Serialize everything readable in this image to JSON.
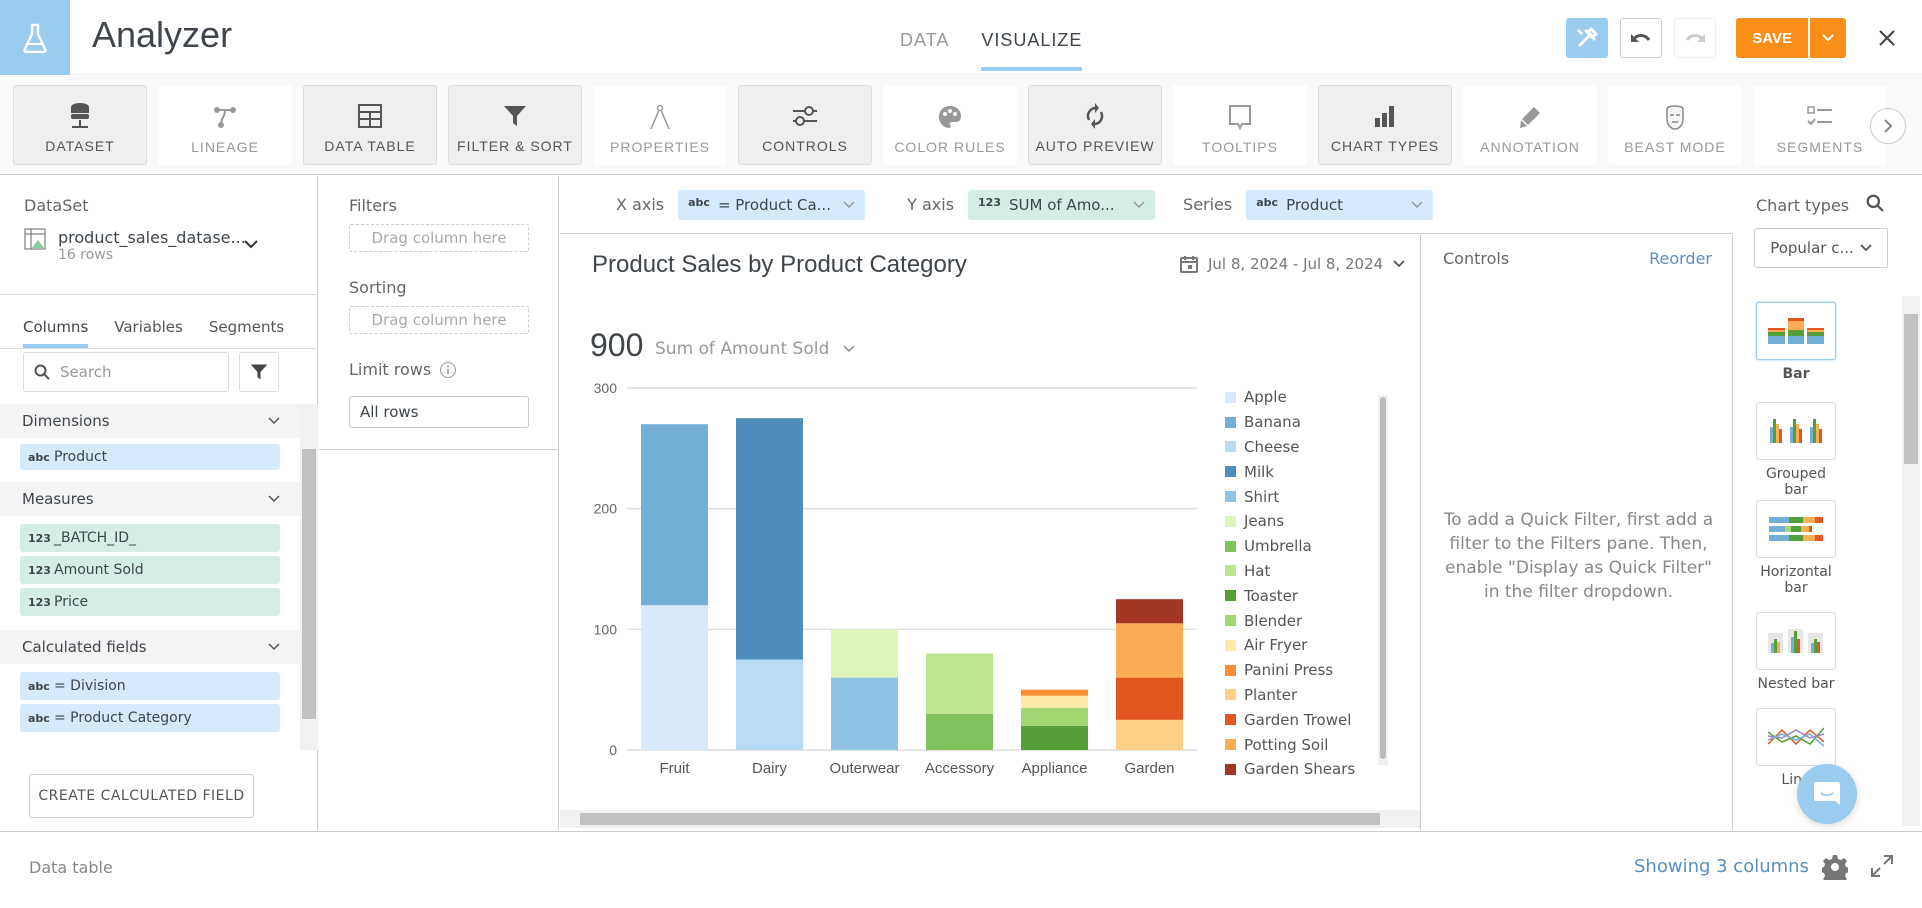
{
  "app": {
    "title": "Analyzer",
    "logo_icon": "flask-icon"
  },
  "nav": {
    "tabs": [
      {
        "label": "DATA",
        "active": false
      },
      {
        "label": "VISUALIZE",
        "active": true
      }
    ]
  },
  "header_actions": {
    "save_label": "SAVE",
    "tools_icon": "tools-icon",
    "undo_icon": "undo-icon",
    "redo_icon": "redo-icon",
    "close_icon": "close-icon"
  },
  "toolbar": {
    "items": [
      {
        "label": "DATASET",
        "icon": "database-icon",
        "active": true
      },
      {
        "label": "LINEAGE",
        "icon": "lineage-icon",
        "active": false
      },
      {
        "label": "DATA TABLE",
        "icon": "table-icon",
        "active": true
      },
      {
        "label": "FILTER & SORT",
        "icon": "filter-icon",
        "active": true
      },
      {
        "label": "PROPERTIES",
        "icon": "compass-icon",
        "active": false
      },
      {
        "label": "CONTROLS",
        "icon": "sliders-icon",
        "active": true
      },
      {
        "label": "COLOR RULES",
        "icon": "palette-icon",
        "active": false
      },
      {
        "label": "AUTO PREVIEW",
        "icon": "refresh-icon",
        "active": true
      },
      {
        "label": "TOOLTIPS",
        "icon": "tooltip-icon",
        "active": false
      },
      {
        "label": "CHART TYPES",
        "icon": "bar-chart-icon",
        "active": true
      },
      {
        "label": "ANNOTATION",
        "icon": "pencil-icon",
        "active": false
      },
      {
        "label": "BEAST MODE",
        "icon": "beast-icon",
        "active": false
      },
      {
        "label": "SEGMENTS",
        "icon": "checklist-icon",
        "active": false
      }
    ]
  },
  "dataset": {
    "label": "DataSet",
    "name": "product_sales_datase...",
    "rows": "16 rows",
    "tabs": [
      {
        "label": "Columns",
        "active": true
      },
      {
        "label": "Variables",
        "active": false
      },
      {
        "label": "Segments",
        "active": false
      }
    ],
    "search_placeholder": "Search",
    "sections": [
      {
        "title": "Dimensions",
        "fields": [
          {
            "type": "abc",
            "name": "Product"
          }
        ]
      },
      {
        "title": "Measures",
        "fields": [
          {
            "type": "123",
            "name": "_BATCH_ID_"
          },
          {
            "type": "123",
            "name": "Amount Sold"
          },
          {
            "type": "123",
            "name": "Price"
          }
        ]
      },
      {
        "title": "Calculated fields",
        "fields": [
          {
            "type": "abc",
            "name": "= Division"
          },
          {
            "type": "abc",
            "name": "= Product Category"
          }
        ]
      }
    ],
    "create_button": "CREATE CALCULATED FIELD"
  },
  "filters": {
    "filters_label": "Filters",
    "filters_drop": "Drag column here",
    "sorting_label": "Sorting",
    "sorting_drop": "Drag column here",
    "limit_label": "Limit rows",
    "limit_value": "All rows"
  },
  "axes": {
    "x_label": "X axis",
    "x_type": "abc",
    "x_value": "= Product Ca...",
    "y_label": "Y axis",
    "y_type": "123",
    "y_value": "SUM of Amo...",
    "series_label": "Series",
    "series_type": "abc",
    "series_value": "Product"
  },
  "chart_header": {
    "title": "Product Sales by Product Category",
    "date_range": "Jul 8, 2024 - Jul 8, 2024",
    "total": "900",
    "measure": "Sum of Amount Sold"
  },
  "chart_data": {
    "type": "bar",
    "stacked": true,
    "title": "Product Sales by Product Category",
    "xlabel": "",
    "ylabel": "Sum of Amount Sold",
    "ylim": [
      0,
      300
    ],
    "yticks": [
      0,
      100,
      200,
      300
    ],
    "grid": true,
    "legend_position": "right",
    "categories": [
      "Fruit",
      "Dairy",
      "Outerwear",
      "Accessory",
      "Appliance",
      "Garden"
    ],
    "series": [
      {
        "name": "Apple",
        "color": "#d9e9fa",
        "values": [
          120,
          0,
          0,
          0,
          0,
          0
        ]
      },
      {
        "name": "Banana",
        "color": "#73afd7",
        "values": [
          150,
          0,
          0,
          0,
          0,
          0
        ]
      },
      {
        "name": "Cheese",
        "color": "#b7dbf4",
        "values": [
          0,
          75,
          0,
          0,
          0,
          0
        ]
      },
      {
        "name": "Milk",
        "color": "#4e8cba",
        "values": [
          0,
          200,
          0,
          0,
          0,
          0
        ]
      },
      {
        "name": "Shirt",
        "color": "#90c4e4",
        "values": [
          0,
          0,
          60,
          0,
          0,
          0
        ]
      },
      {
        "name": "Jeans",
        "color": "#ddf4ba",
        "values": [
          0,
          0,
          40,
          0,
          0,
          0
        ]
      },
      {
        "name": "Umbrella",
        "color": "#80c25d",
        "values": [
          0,
          0,
          0,
          30,
          0,
          0
        ]
      },
      {
        "name": "Hat",
        "color": "#bee48f",
        "values": [
          0,
          0,
          0,
          50,
          0,
          0
        ]
      },
      {
        "name": "Toaster",
        "color": "#559e38",
        "values": [
          0,
          0,
          0,
          0,
          20,
          0
        ]
      },
      {
        "name": "Blender",
        "color": "#a0d771",
        "values": [
          0,
          0,
          0,
          0,
          15,
          0
        ]
      },
      {
        "name": "Air Fryer",
        "color": "#fde9a8",
        "values": [
          0,
          0,
          0,
          0,
          10,
          0
        ]
      },
      {
        "name": "Panini Press",
        "color": "#fb8d34",
        "values": [
          0,
          0,
          0,
          0,
          5,
          0
        ]
      },
      {
        "name": "Planter",
        "color": "#fdd086",
        "values": [
          0,
          0,
          0,
          0,
          0,
          25
        ]
      },
      {
        "name": "Garden Trowel",
        "color": "#e45621",
        "values": [
          0,
          0,
          0,
          0,
          0,
          35
        ]
      },
      {
        "name": "Potting Soil",
        "color": "#fbad56",
        "values": [
          0,
          0,
          0,
          0,
          0,
          45
        ]
      },
      {
        "name": "Garden Shears",
        "color": "#a43724",
        "values": [
          0,
          0,
          0,
          0,
          0,
          20
        ]
      }
    ]
  },
  "controls": {
    "title": "Controls",
    "reorder": "Reorder",
    "message": "To add a Quick Filter, first add a filter to the Filters pane. Then, enable \"Display as Quick Filter\" in the filter dropdown."
  },
  "chart_types": {
    "title": "Chart types",
    "select_value": "Popular c...",
    "items": [
      {
        "label": "Bar",
        "selected": true
      },
      {
        "label": "Grouped bar",
        "selected": false
      },
      {
        "label": "Horizontal bar",
        "selected": false
      },
      {
        "label": "Nested bar",
        "selected": false
      },
      {
        "label": "Line",
        "selected": false
      }
    ]
  },
  "bottom": {
    "label": "Data table",
    "showing": "Showing 3 columns"
  },
  "colors": {
    "accent": "#99ccee",
    "save": "#f98e19",
    "link": "#5b8fbf",
    "dimension": "#d6eafb",
    "measure": "#d5ede5"
  }
}
